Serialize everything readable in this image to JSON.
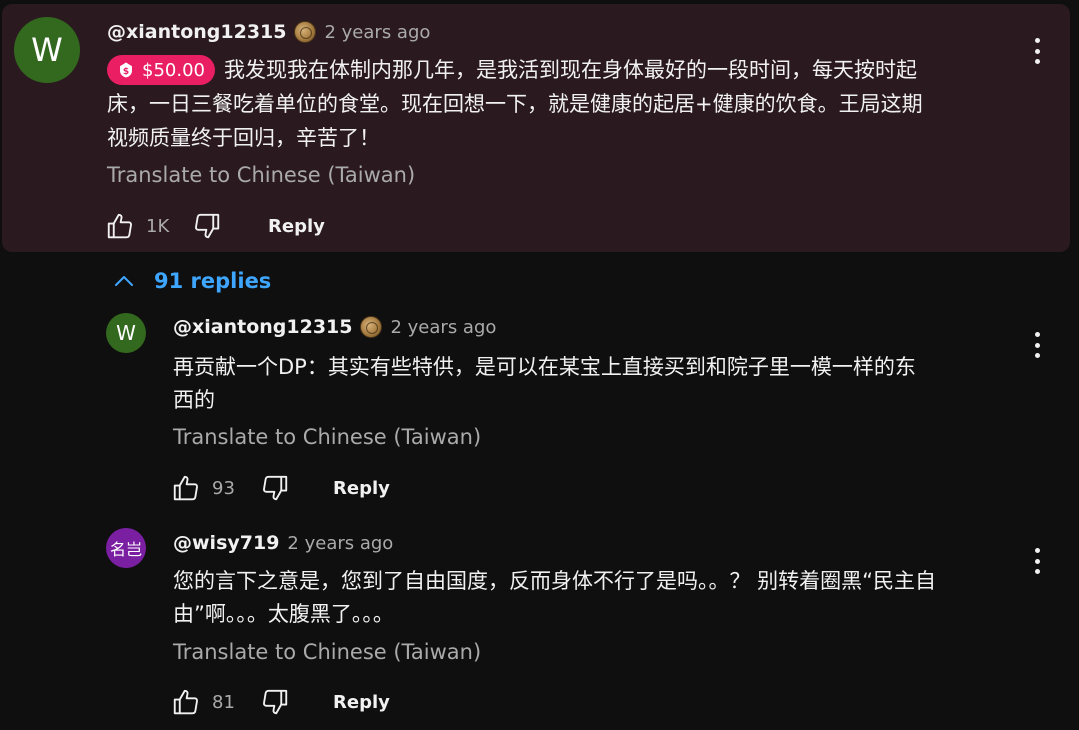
{
  "comment": {
    "avatar_letter": "W",
    "author": "@xiantong12315",
    "timestamp": "2 years ago",
    "super_chat_amount": "$50.00",
    "text_lines": [
      "我发现我在体制内那几年，是我活到现在身体最好的一段时间，每天按时起",
      "床，一日三餐吃着单位的食堂。现在回想一下，就是健康的起居+健康的饮食。王局这期",
      "视频质量终于回归，辛苦了！"
    ],
    "translate_label": "Translate to Chinese (Taiwan)",
    "like_count": "1K",
    "reply_label": "Reply",
    "background_color": "#2a1a1f",
    "chip_color": "#e91e63"
  },
  "replies_toggle": {
    "label": "91 replies",
    "color": "#3ea6ff"
  },
  "replies": [
    {
      "avatar_letter": "W",
      "author": "@xiantong12315",
      "timestamp": "2 years ago",
      "text_lines": [
        "再贡献一个DP：其实有些特供，是可以在某宝上直接买到和院子里一模一样的东",
        "西的"
      ],
      "translate_label": "Translate to Chinese (Taiwan)",
      "like_count": "93",
      "reply_label": "Reply"
    },
    {
      "avatar_letter": "名岂",
      "author": "@wisy719",
      "timestamp": "2 years ago",
      "text_lines": [
        "您的言下之意是，您到了自由国度，反而身体不行了是吗。。？ 别转着圈黑“民主自",
        "由”啊。。。太腹黑了。。。"
      ],
      "translate_label": "Translate to Chinese (Taiwan)",
      "like_count": "81",
      "reply_label": "Reply"
    }
  ],
  "icons": {
    "like": "thumbs-up-icon",
    "dislike": "thumbs-down-icon",
    "more": "more-vert-icon",
    "chevron": "chevron-up-icon",
    "money": "money-bag-icon",
    "badge": "member-badge-icon"
  }
}
